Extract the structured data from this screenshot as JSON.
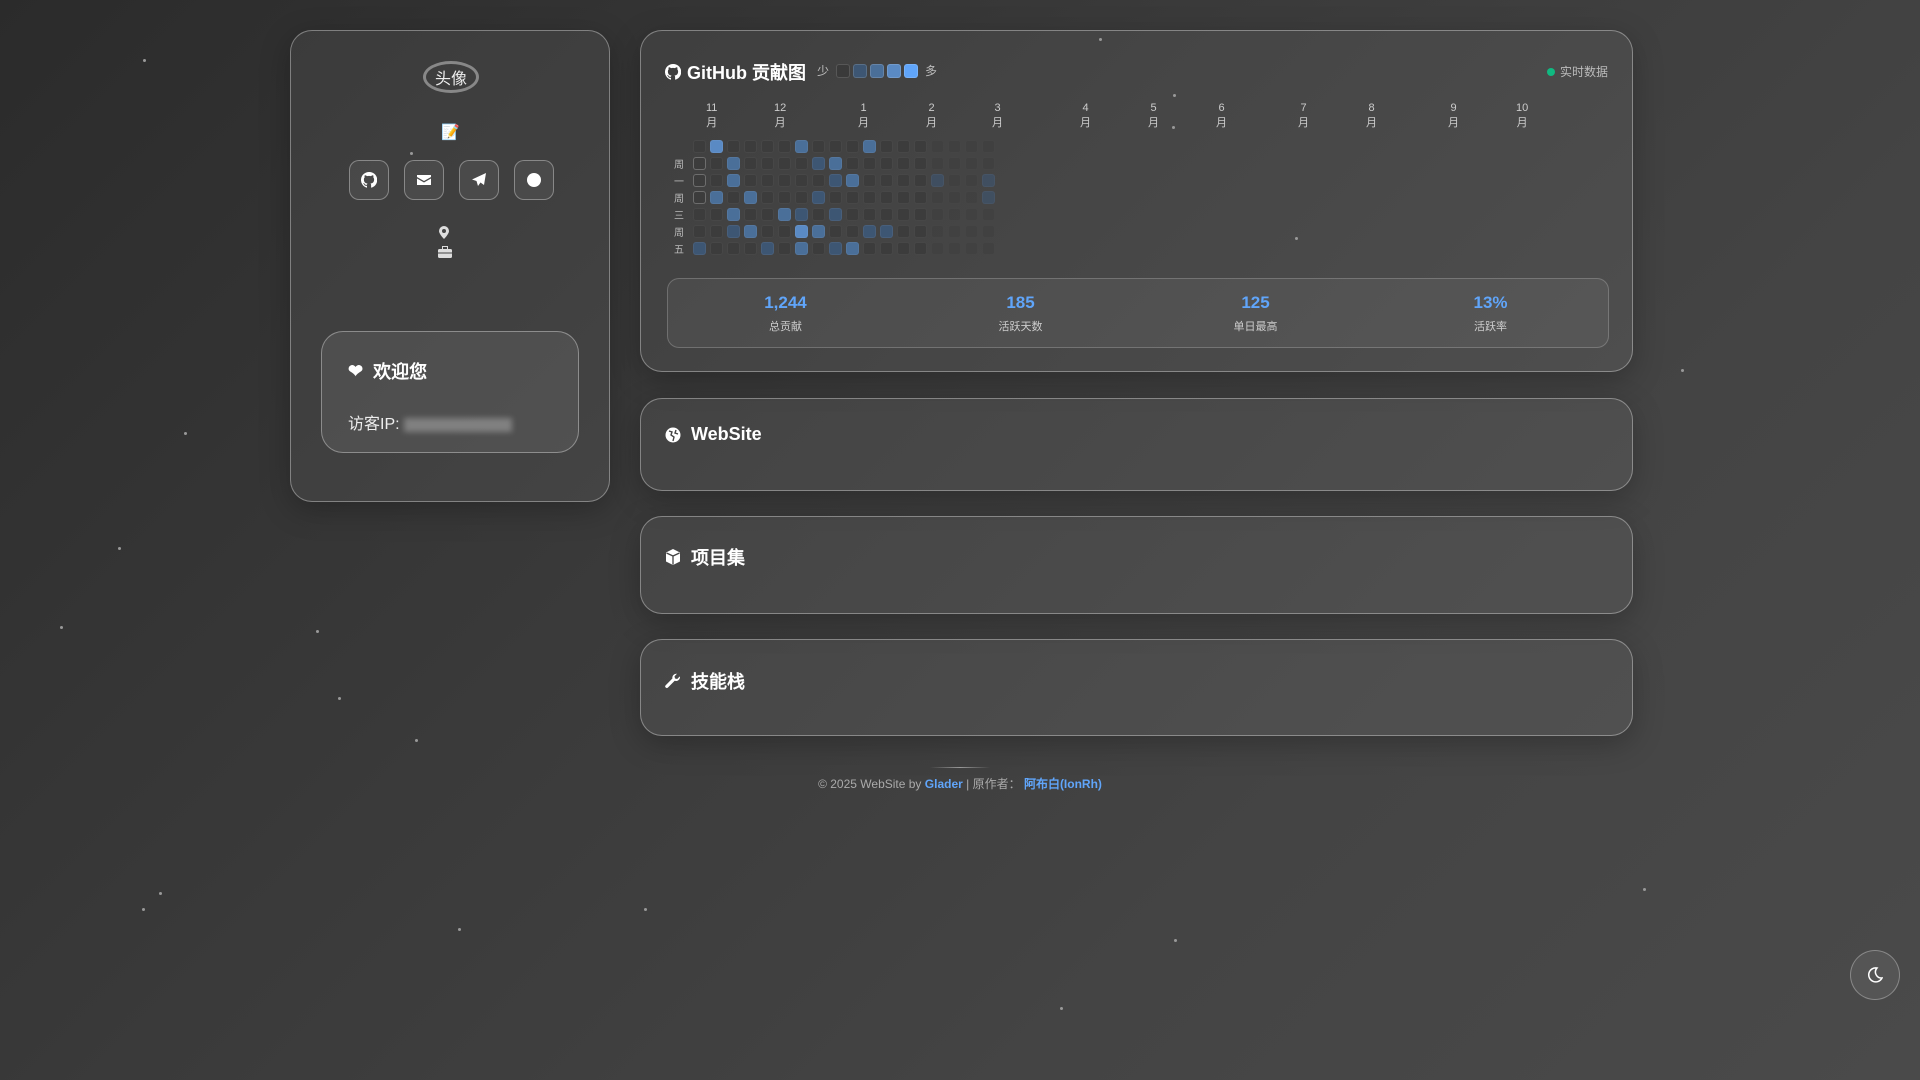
{
  "profile": {
    "avatar_alt": "头像",
    "bio_icon": "📝",
    "socials": [
      "github-icon",
      "envelope-icon",
      "paper-plane-icon",
      "circle-icon"
    ]
  },
  "welcome": {
    "title": "欢迎您",
    "ip_label": "访客IP:"
  },
  "github": {
    "title": "GitHub 贡献图",
    "less": "少",
    "more": "多",
    "live": "实时数据",
    "legend_colors": [
      "#3a3a3a",
      "#3d5673",
      "#4a6f99",
      "#5a8ac4",
      "#60a5fa"
    ],
    "months": [
      {
        "n": "11",
        "l": "月"
      },
      {
        "n": "12",
        "l": "月"
      },
      {
        "n": "1",
        "l": "月"
      },
      {
        "n": "2",
        "l": "月"
      },
      {
        "n": "3",
        "l": "月"
      },
      {
        "n": "4",
        "l": "月"
      },
      {
        "n": "5",
        "l": "月"
      },
      {
        "n": "6",
        "l": "月"
      },
      {
        "n": "7",
        "l": "月"
      },
      {
        "n": "8",
        "l": "月"
      },
      {
        "n": "9",
        "l": "月"
      },
      {
        "n": "10",
        "l": "月"
      }
    ],
    "day_labels": [
      "周一",
      "周三",
      "周五"
    ],
    "levels": [
      [
        0,
        3,
        0,
        0,
        0,
        0,
        2,
        0,
        0,
        0,
        2,
        0,
        0,
        0,
        0,
        0,
        0,
        0
      ],
      [
        0,
        0,
        2,
        0,
        0,
        0,
        0,
        1,
        2,
        0,
        0,
        0,
        0,
        0,
        0,
        0,
        0,
        0
      ],
      [
        0,
        0,
        2,
        0,
        0,
        0,
        0,
        0,
        1,
        2,
        0,
        0,
        0,
        0,
        1,
        0,
        0,
        1
      ],
      [
        0,
        2,
        0,
        2,
        0,
        0,
        0,
        1,
        0,
        0,
        0,
        0,
        0,
        0,
        0,
        0,
        0,
        1
      ],
      [
        0,
        0,
        2,
        0,
        0,
        2,
        1,
        0,
        1,
        0,
        0,
        0,
        0,
        0,
        0,
        0,
        0,
        0
      ],
      [
        0,
        0,
        1,
        2,
        0,
        0,
        3,
        2,
        0,
        0,
        1,
        1,
        0,
        0,
        0,
        0,
        0,
        0
      ],
      [
        1,
        0,
        0,
        0,
        1,
        0,
        2,
        0,
        1,
        2,
        0,
        0,
        0,
        0,
        0,
        0,
        0,
        0
      ]
    ],
    "stats": [
      {
        "value": "1,244",
        "label": "总贡献"
      },
      {
        "value": "185",
        "label": "活跃天数"
      },
      {
        "value": "125",
        "label": "单日最高"
      },
      {
        "value": "13%",
        "label": "活跃率"
      }
    ]
  },
  "sections": {
    "website": "WebSite",
    "projects": "项目集",
    "skills": "技能栈"
  },
  "footer": {
    "prefix": "© 2025 WebSite by",
    "author": "Glader",
    "sep": "| 原作者：",
    "original": "阿布白(IonRh)"
  }
}
